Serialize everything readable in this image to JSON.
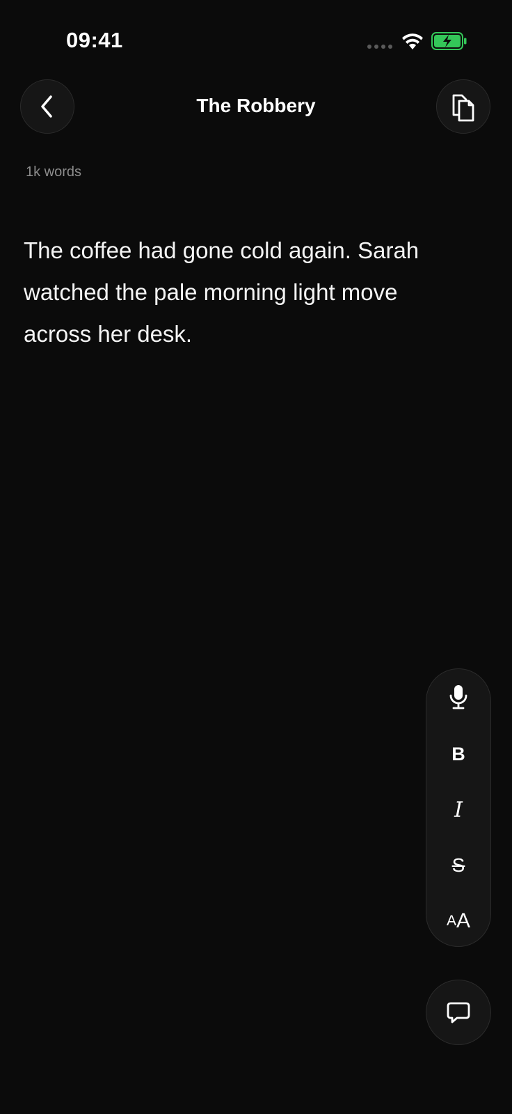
{
  "status_bar": {
    "time": "09:41",
    "signal_icon": "signal-dots-icon",
    "wifi_icon": "wifi-icon",
    "battery_icon": "battery-charging-icon",
    "battery_color": "#34c759"
  },
  "header": {
    "title": "The Robbery",
    "back_icon": "chevron-left-icon",
    "copy_icon": "copy-icon"
  },
  "document": {
    "word_count": "1k words",
    "text": "The coffee had gone cold again. Sarah watched the pale morning light move across her desk."
  },
  "toolbar": {
    "mic_icon": "microphone-icon",
    "bold_label": "B",
    "italic_label": "I",
    "strike_label": "S",
    "size_small_label": "A",
    "size_large_label": "A"
  },
  "comment_button": {
    "icon": "comment-icon"
  },
  "colors": {
    "background": "#0b0b0b",
    "surface": "#161616",
    "muted_text": "#8d8d8d"
  }
}
